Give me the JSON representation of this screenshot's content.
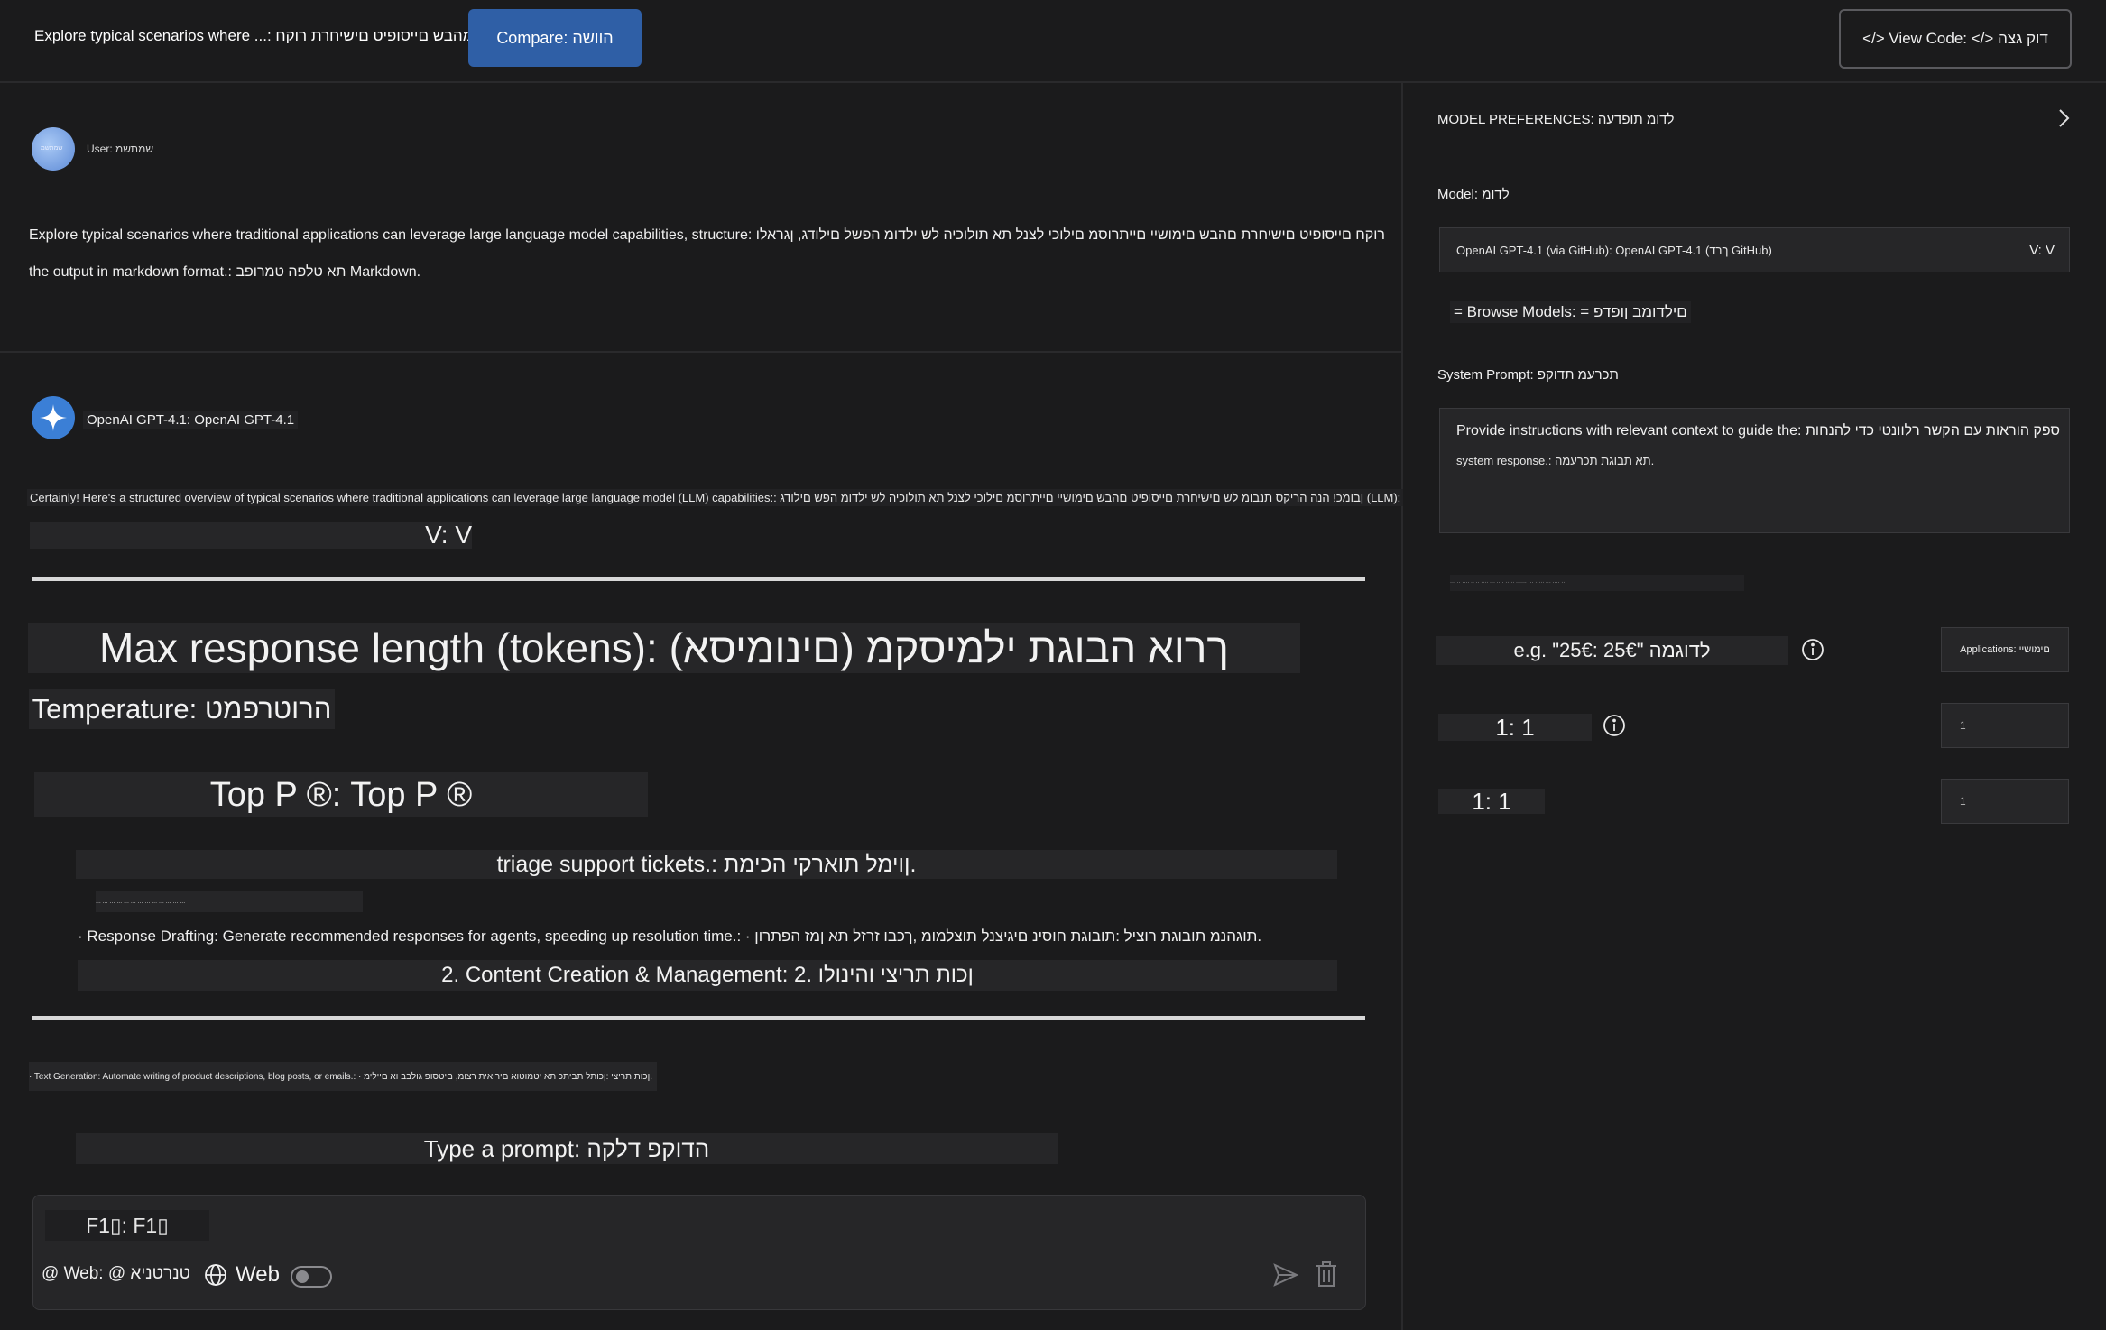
{
  "header": {
    "tab_title": "Explore typical scenarios where ...: מהבש םייסופיט םישיחרת רוקח ...",
    "compare_label": "Compare: הוושה",
    "view_code_label": "</> View Code: </> דוק גצה"
  },
  "chat": {
    "user_avatar_text": "שמתשמ",
    "user_name": "User: שמתשמ",
    "user_message_line1": "Explore typical scenarios where traditional applications can leverage large language model capabilities, structure: רוקח םייסופיט םישיחרת םהבש םימושיי םייתרוסמ םילוכי לצנל תא תולוכיה לש ילדומ הפשל םילודג, ןגראלו",
    "user_message_line2": "the output in markdown format.: תא טלפה טמרופב Markdown.",
    "bot_name": "OpenAI GPT-4.1: OpenAI GPT-4.1",
    "bot_intro": "Certainly! Here's a structured overview of typical scenarios where traditional applications can leverage large language model (LLM) capabilities:: ןבומכ! הנה הריקס תנבומ לש םישיחרת םייסופיט םהבש םימושיי םייתרוסמ םילוכי לצנל תא תולוכיה לש ילדומ הפש םילודג (LLM):",
    "vv": "V: V",
    "max_response": "Max response length (tokens): ךרוא הבוגת ילמיסקמ (םינומיסא)",
    "temperature": "Temperature: הרוטרפמט",
    "top_p": "Top P ®: Top P ®",
    "triage": "triage support tickets.: ןוימל תוארקי הכימת.",
    "tiny_line": "... ... ... ... ... ... ... ... ... ... ... ... ...",
    "drafting": "· Response Drafting: Generate recommended responses for agents, speeding up resolution time.: · תוגהנמ תובוגת רוציל :תובוגת חוסינ םיגיצנל תוצלמומ ,ךכבו זרזל תא ןמז הפתרון.",
    "content_creation": "2. Content Creation & Management: 2. ןכות תריצי והינולו",
    "text_generation": "· Text Generation: Automate writing of product descriptions, blog posts, or emails.: · ןכות תריצי :ןכותל תביתכ תא יטמוטוא םירואית רצומ, םיטסופ גולבב וא םיילימ.",
    "type_prompt": "Type a prompt: הדוקפ דלקה",
    "input_value": "F1▯: F1▯",
    "web_at": "@ Web: @ טנרטניא",
    "web_label": "Web",
    "web_toggle_on": false
  },
  "preferences": {
    "title": "MODEL PREFERENCES: לדומ תופדעה",
    "model_label": "Model: לדומ",
    "model_value": "OpenAI GPT-4.1 (via GitHub): OpenAI GPT-4.1 (ךרד GitHub)",
    "model_chevron": "V: V",
    "browse_models": "= Browse Models: = םילדומב ןופדפ",
    "system_prompt_label": "System Prompt: תכרעמ תדוקפ",
    "system_prompt_line1": "Provide instructions with relevant context to guide the: ספק הוראות עם הקשר רלוונטי כדי להנחות",
    "system_prompt_line2": "system response.: תא תבוגת תכרעמה.",
    "tiny_hint": "··· ·· ···· ·· ·· ···· ··· ···· ····· ······ ··· ····· ··· ···· ··",
    "eg_placeholder": "e.g. \"25€: 25€\" לדוגמה",
    "applications_button": "Applications: םימושיי",
    "value_1": "1: 1",
    "value_2": "1: 1",
    "numbox_1": "1",
    "numbox_2": "1"
  },
  "colors": {
    "background": "#1b1b1c",
    "accent": "#2f5fa6",
    "panel": "#262628"
  },
  "icons": [
    "user-avatar",
    "openai-sparkle-icon",
    "globe-icon",
    "send-icon",
    "trash-icon",
    "info-icon",
    "chevron-right-icon"
  ]
}
